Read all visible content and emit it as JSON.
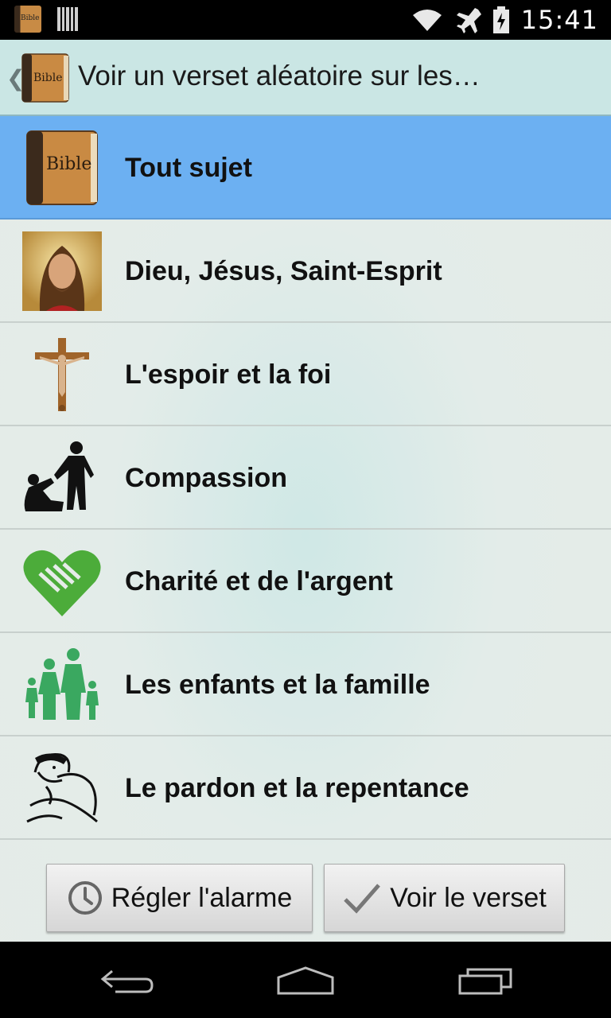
{
  "status_bar": {
    "time": "15:41",
    "app_icon_text": "Bible",
    "icons": [
      "app-icon",
      "barcode-icon",
      "wifi-icon",
      "airplane-icon",
      "battery-icon"
    ]
  },
  "action_bar": {
    "icon_text": "Bible",
    "title": "Voir un verset aléatoire sur les…"
  },
  "topics": [
    {
      "label": "Tout sujet",
      "icon": "bible-book-icon",
      "selected": true
    },
    {
      "label": "Dieu, Jésus, Saint-Esprit",
      "icon": "jesus-portrait-icon",
      "selected": false
    },
    {
      "label": "L'espoir et la foi",
      "icon": "crucifix-icon",
      "selected": false
    },
    {
      "label": "Compassion",
      "icon": "helping-hand-icon",
      "selected": false
    },
    {
      "label": "Charité et de l'argent",
      "icon": "heart-hands-icon",
      "selected": false
    },
    {
      "label": "Les enfants et la famille",
      "icon": "family-icon",
      "selected": false
    },
    {
      "label": "Le pardon et la repentance",
      "icon": "embrace-icon",
      "selected": false
    }
  ],
  "buttons": {
    "alarm_label": "Régler l'alarme",
    "verse_label": "Voir le verset"
  },
  "colors": {
    "selected_row": "#6cb0f2",
    "action_bar": "#cae6e4",
    "icon_green": "#4cac3a"
  },
  "nav_bar": {
    "icons": [
      "back-icon",
      "home-icon",
      "recent-apps-icon"
    ]
  }
}
